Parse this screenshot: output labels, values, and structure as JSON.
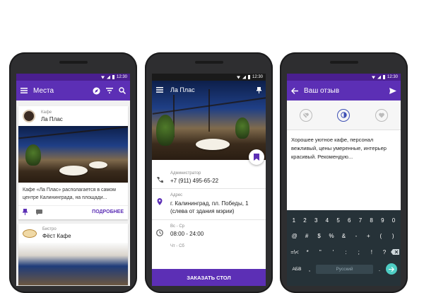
{
  "status": {
    "time": "12:30"
  },
  "phone1": {
    "appbar": {
      "title": "Места"
    },
    "card1": {
      "category": "Кафе",
      "name": "Ла Плас",
      "description": "Кафе «Ла Плас» располагается в самом центре Калининграда, на площади...",
      "more_label": "ПОДРОБНЕЕ"
    },
    "card2": {
      "category": "Бистро",
      "name": "Фёст Кафе"
    }
  },
  "phone2": {
    "appbar": {
      "title": "Ла Плас"
    },
    "details": [
      {
        "label": "Администратор",
        "value": "+7 (911) 495-65-22",
        "icon": "phone-icon"
      },
      {
        "label": "Адрес",
        "value": "г. Калининград, пл. Победы, 1 (слева от здания мэрии)",
        "icon": "location-icon"
      },
      {
        "label": "Вс - Ср",
        "value": "08:00 - 24:00",
        "icon": "clock-icon"
      },
      {
        "label": "Чт - Сб",
        "value": "",
        "icon": ""
      }
    ],
    "order_button": "ЗАКАЗАТЬ СТОЛ"
  },
  "phone3": {
    "appbar": {
      "title": "Ваш отзыв"
    },
    "review_text": "Хорошее уютное кафе, персонал вежливый, цены умеренные, интерьер красивый. Рекомендую...",
    "keyboard": {
      "row1": [
        "1",
        "2",
        "3",
        "4",
        "5",
        "6",
        "7",
        "8",
        "9",
        "0"
      ],
      "row2": [
        "@",
        "#",
        "$",
        "%",
        "&",
        "-",
        "+",
        "(",
        ")"
      ],
      "row3": [
        "=\\<",
        "*",
        "\"",
        "'",
        ":",
        ";",
        "!",
        "?"
      ],
      "row4_left": "АБВ",
      "row4_comma": ",",
      "row4_space": "Русский",
      "row4_dot": "."
    }
  },
  "colors": {
    "primary": "#5c2fb5",
    "primary_dark": "#4a1f8f",
    "keyboard_bg": "#263238",
    "accent_green": "#4ecdc4"
  }
}
